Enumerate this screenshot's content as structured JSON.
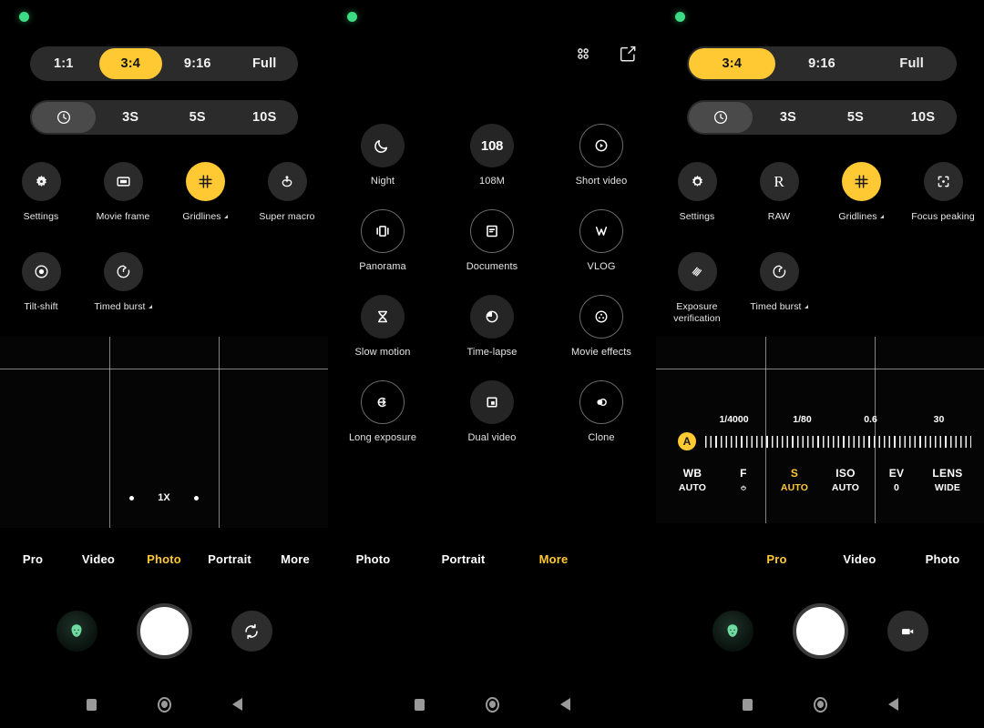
{
  "colors": {
    "accent": "#FFC933",
    "bg": "#000000",
    "pill": "#2b2b2b",
    "pill_selected": "#4a4a4a",
    "privacy_dot": "#3ddc84"
  },
  "panel1": {
    "ratio_bar": {
      "options": [
        "1:1",
        "3:4",
        "9:16",
        "Full"
      ],
      "selected": "3:4"
    },
    "timer_bar": {
      "options": [
        "timer-icon",
        "3S",
        "5S",
        "10S"
      ],
      "selected": "timer-icon"
    },
    "options_row1": [
      {
        "label": "Settings",
        "icon": "settings-gear-icon",
        "active": false,
        "expandable": false
      },
      {
        "label": "Movie frame",
        "icon": "movie-frame-icon",
        "active": false,
        "expandable": false
      },
      {
        "label": "Gridlines",
        "icon": "gridlines-icon",
        "active": true,
        "expandable": true
      },
      {
        "label": "Super macro",
        "icon": "super-macro-icon",
        "active": false,
        "expandable": false
      }
    ],
    "options_row2": [
      {
        "label": "Tilt-shift",
        "icon": "tilt-shift-icon",
        "active": false,
        "expandable": false
      },
      {
        "label": "Timed burst",
        "icon": "timed-burst-icon",
        "active": false,
        "expandable": true
      }
    ],
    "viewfinder": {
      "zoom_label": "1X"
    },
    "tabs": [
      {
        "label": "Pro",
        "active": false
      },
      {
        "label": "Video",
        "active": false
      },
      {
        "label": "Photo",
        "active": true
      },
      {
        "label": "Portrait",
        "active": false
      },
      {
        "label": "More",
        "active": false
      }
    ],
    "shutter": {
      "thumbnail": "gallery-thumbnail",
      "capture": "shutter-button",
      "switch": "switch-camera-icon"
    }
  },
  "panel2": {
    "top_icons": [
      {
        "name": "grid-view-icon"
      },
      {
        "name": "edit-modes-icon"
      }
    ],
    "modes": [
      [
        {
          "label": "Night",
          "icon": "moon-icon",
          "style": "filled"
        },
        {
          "label": "108M",
          "icon": "108-text-icon",
          "style": "filled"
        },
        {
          "label": "Short video",
          "icon": "play-circle-icon",
          "style": "ring"
        }
      ],
      [
        {
          "label": "Panorama",
          "icon": "panorama-icon",
          "style": "ring"
        },
        {
          "label": "Documents",
          "icon": "document-icon",
          "style": "ring"
        },
        {
          "label": "VLOG",
          "icon": "vlog-heart-icon",
          "style": "ring"
        }
      ],
      [
        {
          "label": "Slow motion",
          "icon": "hourglass-icon",
          "style": "filled"
        },
        {
          "label": "Time-lapse",
          "icon": "time-lapse-icon",
          "style": "filled"
        },
        {
          "label": "Movie effects",
          "icon": "film-reel-icon",
          "style": "ring"
        }
      ],
      [
        {
          "label": "Long exposure",
          "icon": "long-exposure-icon",
          "style": "ring"
        },
        {
          "label": "Dual video",
          "icon": "dual-video-icon",
          "style": "filled"
        },
        {
          "label": "Clone",
          "icon": "clone-icon",
          "style": "ring"
        }
      ]
    ],
    "tabs": [
      {
        "label": "Photo",
        "active": false
      },
      {
        "label": "Portrait",
        "active": false
      },
      {
        "label": "More",
        "active": true
      }
    ]
  },
  "panel3": {
    "ratio_bar": {
      "options": [
        "3:4",
        "9:16",
        "Full"
      ],
      "selected": "3:4"
    },
    "timer_bar": {
      "options": [
        "timer-icon",
        "3S",
        "5S",
        "10S"
      ],
      "selected": "timer-icon"
    },
    "options_row1": [
      {
        "label": "Settings",
        "icon": "settings-gear-icon",
        "active": false,
        "expandable": false
      },
      {
        "label": "RAW",
        "icon": "raw-r-icon",
        "active": false,
        "expandable": false
      },
      {
        "label": "Gridlines",
        "icon": "gridlines-icon",
        "active": true,
        "expandable": true
      },
      {
        "label": "Focus peaking",
        "icon": "focus-peaking-icon",
        "active": false,
        "expandable": false
      }
    ],
    "options_row2": [
      {
        "label": "Exposure verification",
        "icon": "exposure-verification-icon",
        "active": false,
        "expandable": false
      },
      {
        "label": "Timed burst",
        "icon": "timed-burst-icon",
        "active": false,
        "expandable": true
      }
    ],
    "pro": {
      "scale_labels": [
        "1/4000",
        "1/80",
        "0.6",
        "30"
      ],
      "auto_chip": "A",
      "params": [
        {
          "key": "WB",
          "value": "AUTO",
          "selected": false
        },
        {
          "key": "F",
          "value": "aperture-icon",
          "selected": false
        },
        {
          "key": "S",
          "value": "AUTO",
          "selected": true
        },
        {
          "key": "ISO",
          "value": "AUTO",
          "selected": false
        },
        {
          "key": "EV",
          "value": "0",
          "selected": false
        },
        {
          "key": "LENS",
          "value": "WIDE",
          "selected": false
        }
      ]
    },
    "tabs": [
      {
        "label": "Pro",
        "active": true
      },
      {
        "label": "Video",
        "active": false
      },
      {
        "label": "Photo",
        "active": false
      }
    ],
    "shutter": {
      "thumbnail": "gallery-thumbnail",
      "capture": "shutter-button",
      "switch": "video-camera-icon"
    }
  },
  "navbar": {
    "items": [
      "recents-square-icon",
      "home-circle-icon",
      "back-triangle-icon"
    ]
  }
}
